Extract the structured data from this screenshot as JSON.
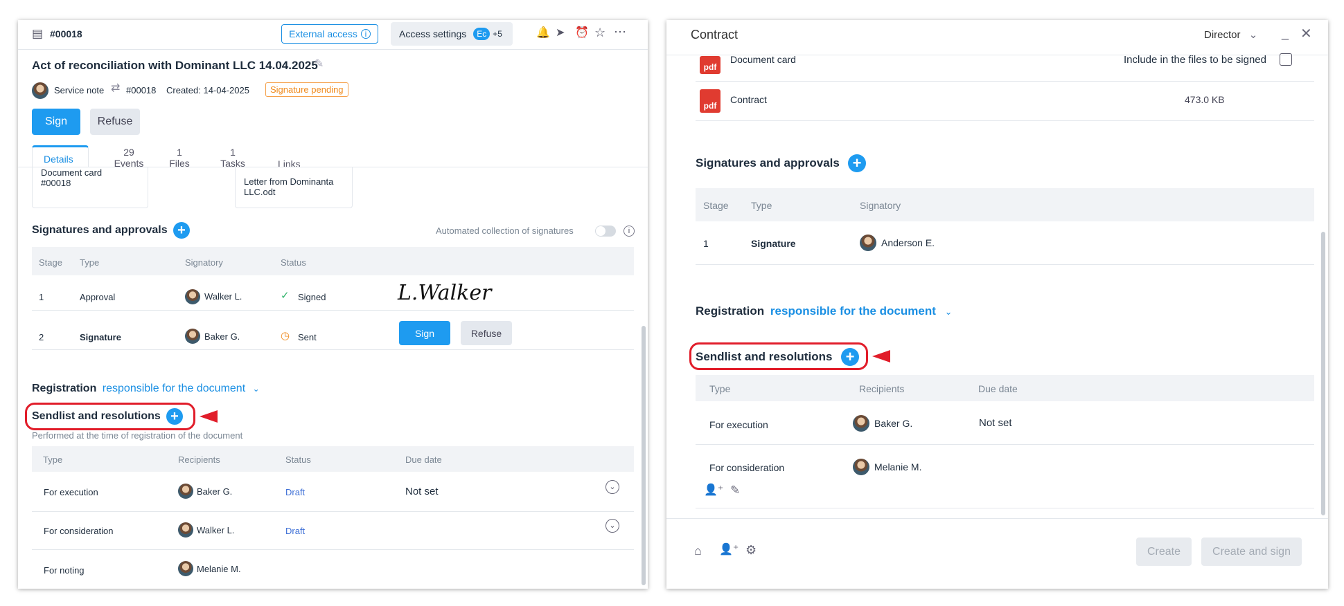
{
  "left": {
    "doc_id": "#00018",
    "external_access": "External access",
    "access_settings": "Access settings",
    "access_avatar": "Ec",
    "access_more": "+5",
    "title": "Act of reconciliation with Dominant LLC 14.04.2025",
    "meta": {
      "type": "Service note",
      "number": "#00018",
      "created": "Created: 14-04-2025",
      "status": "Signature pending"
    },
    "sign_label": "Sign",
    "refuse_label": "Refuse",
    "tabs": [
      {
        "count": "",
        "label": "Details"
      },
      {
        "count": "29",
        "label": "Events"
      },
      {
        "count": "1",
        "label": "Files"
      },
      {
        "count": "1",
        "label": "Tasks"
      },
      {
        "count": "",
        "label": "Links"
      }
    ],
    "file_cards": [
      "Document card\n#00018",
      "Letter from Dominanta LLC.odt"
    ],
    "signatures": {
      "title": "Signatures and approvals",
      "auto_label": "Automated collection of signatures",
      "headers": [
        "Stage",
        "Type",
        "Signatory",
        "Status"
      ],
      "rows": [
        {
          "stage": "1",
          "type": "Approval",
          "signatory": "Walker L.",
          "status": "Signed",
          "signature": "L.Walker"
        },
        {
          "stage": "2",
          "type": "Signature",
          "signatory": "Baker G.",
          "status": "Sent",
          "sign": "Sign",
          "refuse": "Refuse"
        }
      ]
    },
    "registration": {
      "label": "Registration",
      "link": "responsible for the document"
    },
    "sendlist": {
      "title": "Sendlist and resolutions",
      "subtitle": "Performed at the time of registration of the document",
      "headers": [
        "Type",
        "Recipients",
        "Status",
        "Due date"
      ],
      "rows": [
        {
          "type": "For execution",
          "recipient": "Baker G.",
          "status": "Draft",
          "due": "Not set"
        },
        {
          "type": "For consideration",
          "recipient": "Walker L.",
          "status": "Draft",
          "due": ""
        },
        {
          "type": "For noting",
          "recipient": "Melanie M.",
          "status": "",
          "due": ""
        }
      ]
    }
  },
  "right": {
    "title": "Contract",
    "role": "Director",
    "files": [
      {
        "name": "Document card",
        "extra": "Include in the files to be signed"
      },
      {
        "name": "Contract",
        "extra": "473.0 KB"
      }
    ],
    "pdf_label": "pdf",
    "signatures": {
      "title": "Signatures and approvals",
      "headers": [
        "Stage",
        "Type",
        "Signatory"
      ],
      "rows": [
        {
          "stage": "1",
          "type": "Signature",
          "signatory": "Anderson E."
        }
      ]
    },
    "registration": {
      "label": "Registration",
      "link": "responsible for the document"
    },
    "sendlist": {
      "title": "Sendlist and resolutions",
      "headers": [
        "Type",
        "Recipients",
        "Due date"
      ],
      "rows": [
        {
          "type": "For execution",
          "recipient": "Baker G.",
          "due": "Not set"
        },
        {
          "type": "For consideration",
          "recipient": "Melanie M.",
          "due": ""
        }
      ]
    },
    "create_label": "Create",
    "create_sign_label": "Create and sign"
  }
}
